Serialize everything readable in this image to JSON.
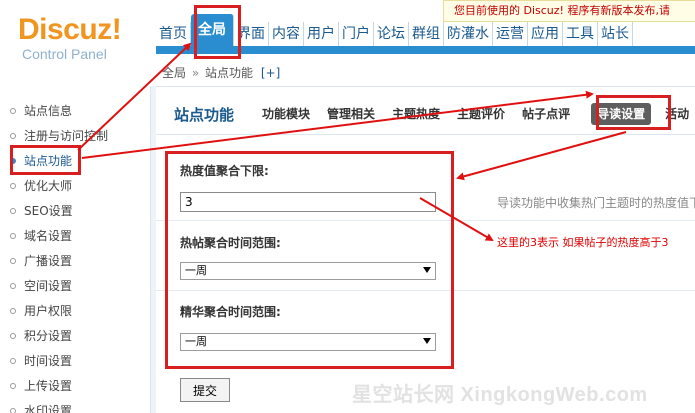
{
  "logo": {
    "name": "Discuz!",
    "sub": "Control Panel"
  },
  "notice": "您目前使用的 Discuz! 程序有新版本发布,请",
  "topnav": [
    "首页",
    "全局",
    "界面",
    "内容",
    "用户",
    "门户",
    "论坛",
    "群组",
    "防灌水",
    "运营",
    "应用",
    "工具",
    "站长"
  ],
  "active_topnav_index": 1,
  "breadcrumb": {
    "a": "全局",
    "sep": "»",
    "b": "站点功能",
    "plus": "[+]"
  },
  "sidebar": [
    "站点信息",
    "注册与访问控制",
    "站点功能",
    "优化大师",
    "SEO设置",
    "域名设置",
    "广播设置",
    "空间设置",
    "用户权限",
    "积分设置",
    "时间设置",
    "上传设置",
    "水印设置"
  ],
  "active_sidebar_index": 2,
  "main_title": "站点功能",
  "subtabs": [
    "功能模块",
    "管理相关",
    "主题热度",
    "主题评价",
    "帖子点评",
    "导读设置",
    "活动"
  ],
  "active_subtab_index": 5,
  "form": {
    "label_heat": "热度值聚合下限:",
    "heat_value": "3",
    "label_hot_range": "热帖聚合时间范围:",
    "hot_range_value": "一周",
    "label_digest_range": "精华聚合时间范围:",
    "digest_range_value": "一周",
    "submit": "提交"
  },
  "help_text": "导读功能中收集热门主题时的热度值下",
  "annotation": "这里的3表示 如果帖子的热度高于3",
  "watermark": "星空站长网 XingkongWeb.com",
  "colors": {
    "accent": "#2a8dd0",
    "annotation": "#d81e1e",
    "logo": "#f0951f"
  }
}
